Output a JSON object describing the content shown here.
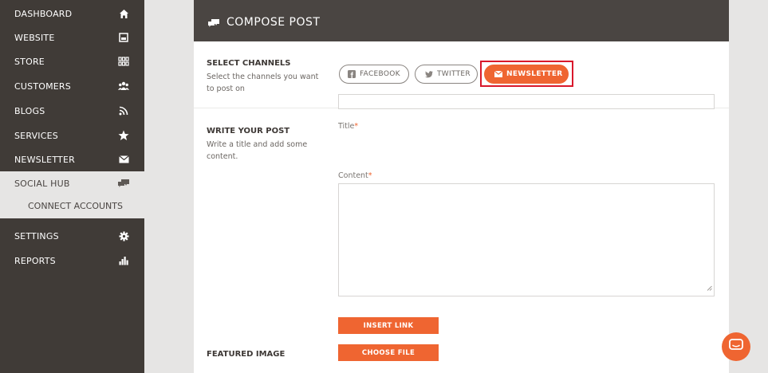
{
  "sidebar": {
    "items": [
      {
        "label": "DASHBOARD",
        "icon": "home-icon"
      },
      {
        "label": "WEBSITE",
        "icon": "monitor-icon"
      },
      {
        "label": "STORE",
        "icon": "store-icon"
      },
      {
        "label": "CUSTOMERS",
        "icon": "users-icon"
      },
      {
        "label": "BLOGS",
        "icon": "rss-icon"
      },
      {
        "label": "SERVICES",
        "icon": "star-icon"
      },
      {
        "label": "NEWSLETTER",
        "icon": "envelope-icon"
      },
      {
        "label": "SOCIAL HUB",
        "icon": "chat-bubbles-icon"
      },
      {
        "label": "SETTINGS",
        "icon": "gear-icon"
      },
      {
        "label": "REPORTS",
        "icon": "bar-chart-icon"
      }
    ],
    "sub_item": "CONNECT ACCOUNTS"
  },
  "compose": {
    "title": "COMPOSE POST",
    "select_channels": {
      "title": "SELECT CHANNELS",
      "description": "Select the channels you want to post on",
      "channels": [
        {
          "label": "FACEBOOK",
          "icon": "facebook-icon",
          "selected": false
        },
        {
          "label": "TWITTER",
          "icon": "twitter-icon",
          "selected": false
        },
        {
          "label": "NEWSLETTER",
          "icon": "envelope-icon",
          "selected": true
        }
      ]
    },
    "write_post": {
      "title": "WRITE YOUR POST",
      "description": "Write a title and add some content.",
      "title_label": "Title",
      "content_label": "Content",
      "required_mark": "*",
      "title_value": "",
      "content_value": ""
    },
    "insert_link_label": "INSERT LINK",
    "featured_image": {
      "title": "FEATURED IMAGE",
      "button_label": "CHOOSE FILE"
    }
  },
  "colors": {
    "accent": "#ef6531",
    "sidebar_bg": "#403b37",
    "header_bg": "#4a4542",
    "highlight": "#d9182b"
  }
}
